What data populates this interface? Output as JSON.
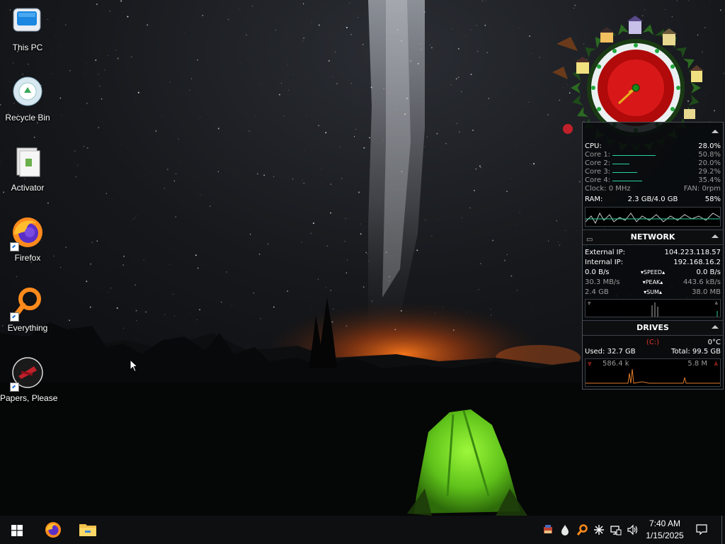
{
  "desktop": {
    "icons": [
      {
        "label": "This PC"
      },
      {
        "label": "Recycle Bin"
      },
      {
        "label": "Activator"
      },
      {
        "label": "Firefox"
      },
      {
        "label": "Everything"
      },
      {
        "label": "Papers, Please"
      }
    ]
  },
  "gadget": {
    "cpu": {
      "label": "CPU:",
      "value": "28.0%",
      "cores": [
        {
          "label": "Core 1:",
          "value": "50.8%",
          "level": 0.508
        },
        {
          "label": "Core 2:",
          "value": "20.0%",
          "level": 0.2
        },
        {
          "label": "Core 3:",
          "value": "29.2%",
          "level": 0.292
        },
        {
          "label": "Core 4:",
          "value": "35.4%",
          "level": 0.354
        }
      ],
      "clock": "Clock: 0 MHz",
      "fan": "FAN: 0rpm",
      "ram_label": "RAM:",
      "ram_value": "2.3 GB/4.0 GB",
      "ram_percent": "58%"
    },
    "network": {
      "title": "NETWORK",
      "external_label": "External IP:",
      "external_ip": "104.223.118.57",
      "internal_label": "Internal IP:",
      "internal_ip": "192.168.16.2",
      "speed_left": "0.0 B/s",
      "speed_label": "SPEED",
      "speed_right": "0.0 B/s",
      "peak_left": "30.3 MB/s",
      "peak_label": "PEAK",
      "peak_right": "443.6 kB/s",
      "sum_left": "2.4 GB",
      "sum_label": "SUM",
      "sum_right": "38.0 MB"
    },
    "drives": {
      "title": "DRIVES",
      "drive": "(C:)",
      "temp": "0°C",
      "used": "Used: 32.7 GB",
      "total": "Total: 99.5 GB",
      "read": "586.4 k",
      "write": "5.8 M"
    }
  },
  "taskbar": {
    "time": "7:40 AM",
    "date": "1/15/2025"
  },
  "colors": {
    "accent_green": "#2ad1a0",
    "drive_red": "#e0342a",
    "graph_orange": "#e07a2a",
    "taskbar": "#0e0f11"
  }
}
